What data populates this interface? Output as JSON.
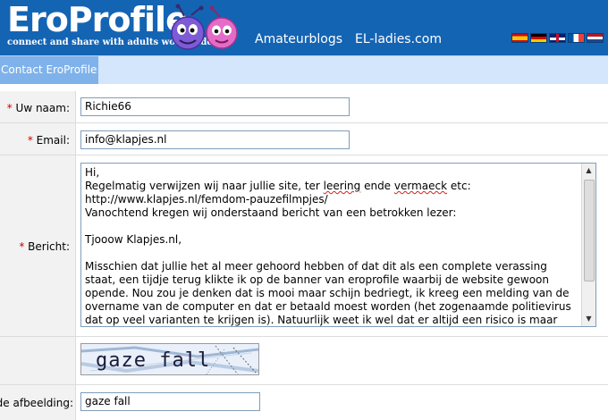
{
  "header": {
    "logo": "EroProfile",
    "logo_reg": "®",
    "tagline": "connect and share with adults worldwide",
    "nav": [
      "Amateurblogs",
      "EL-ladies.com"
    ],
    "flags": [
      "spanish-flag-icon",
      "german-flag-icon",
      "english-flag-icon",
      "french-flag-icon",
      "dutch-flag-icon"
    ]
  },
  "page": {
    "title": "Contact EroProfile"
  },
  "form": {
    "required_mark": "*",
    "name": {
      "label": "Uw naam:",
      "value": "Richie66"
    },
    "email": {
      "label": "Email:",
      "value": "info@klapjes.nl"
    },
    "message": {
      "label": "Bericht:",
      "p1": "Hi,\nRegelmatig verwijzen wij naar jullie site, ter ",
      "w1": "leering",
      "p2": " ende ",
      "w2": "vermaeck",
      "p3": " etc:\nhttp://www.klapjes.nl/femdom-pauzefilmpjes/\nVanochtend kregen wij onderstaand bericht van een betrokken lezer:\n\nTjooow Klapjes.nl,\n\nMisschien dat jullie het al meer gehoord hebben of dat dit als een complete verassing staat, een tijdje terug klikte ik op de banner van eroprofile waarbij de website gewoon opende. Nou zou je denken dat is mooi maar schijn bedriegt, ik kreeg een melding van de overname van de computer en dat er betaald moest worden (het zogenaamde politievirus dat op veel varianten te krijgen is). Natuurlijk weet ik wel dat er altijd een risico is maar eventueel wil ik ook anderen waarschuwen. Mochten jullie de tekst willen gebruiken dan gelieve aan te passen in eigen bewoording."
    },
    "captcha": {
      "text": "gaze fall"
    },
    "captcha_answer": {
      "label": "de afbeelding:",
      "value": "gaze fall"
    }
  }
}
